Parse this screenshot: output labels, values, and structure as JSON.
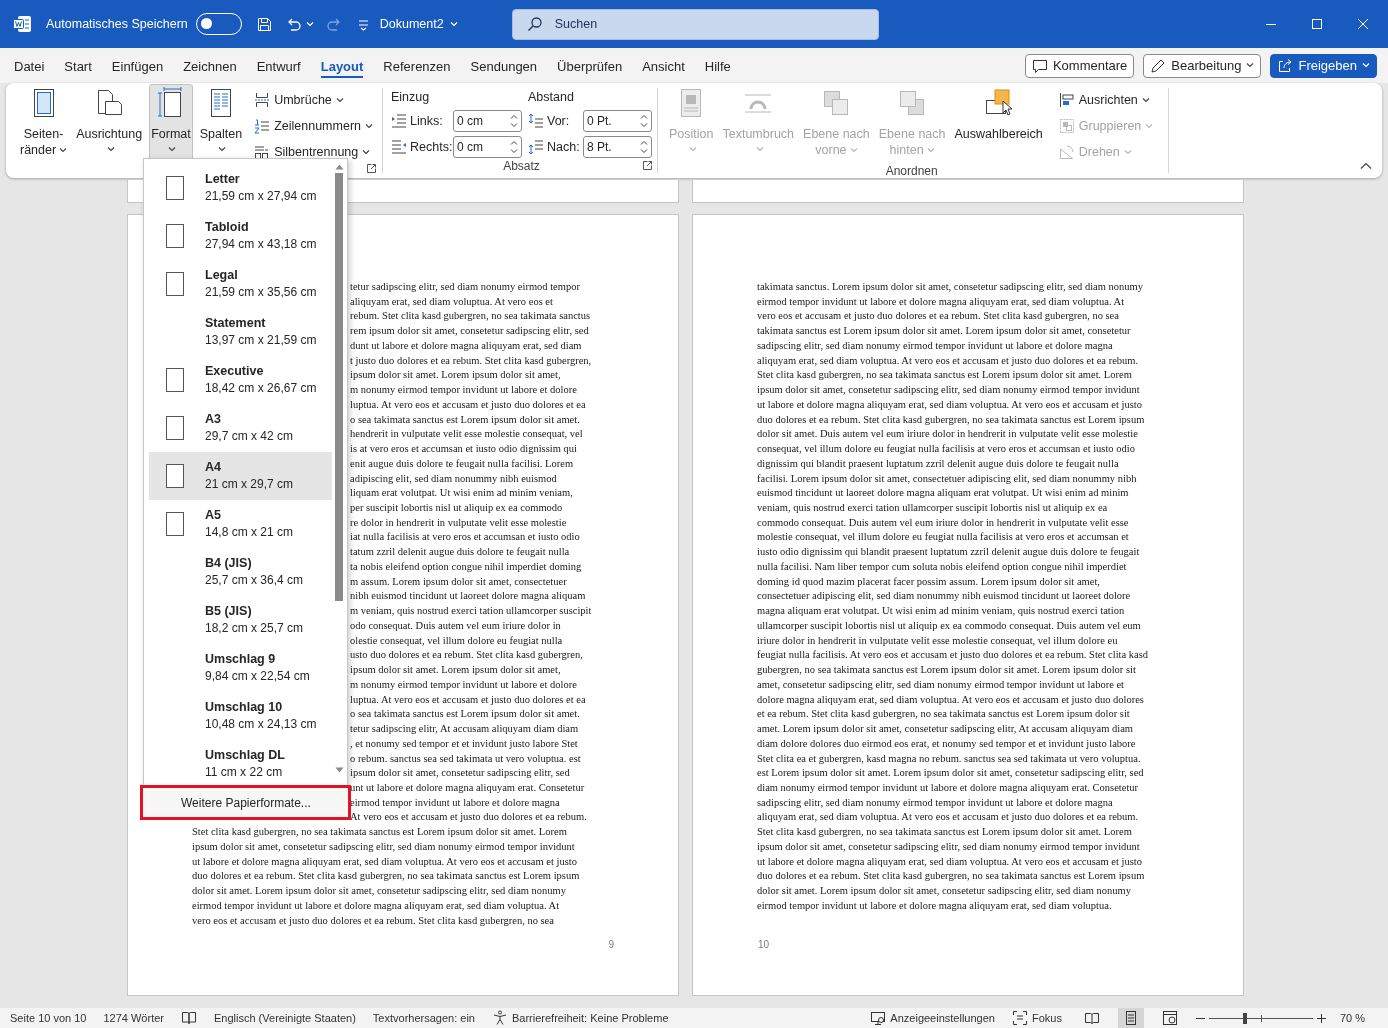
{
  "title_bar": {
    "autosave_label": "Automatisches Speichern",
    "autosave_on": false,
    "quick_access": [
      {
        "kind": "save",
        "disabled": false,
        "dropdown": false
      },
      {
        "kind": "undo",
        "disabled": false,
        "dropdown": true
      },
      {
        "kind": "redo",
        "disabled": true,
        "dropdown": false
      },
      {
        "kind": "customize",
        "disabled": false,
        "dropdown": false
      }
    ],
    "document": "Dokument2",
    "search_placeholder": "Suchen"
  },
  "menu_tabs": [
    {
      "label": "Datei",
      "selected": false
    },
    {
      "label": "Start",
      "selected": false
    },
    {
      "label": "Einfügen",
      "selected": false
    },
    {
      "label": "Zeichnen",
      "selected": false
    },
    {
      "label": "Entwurf",
      "selected": false
    },
    {
      "label": "Layout",
      "selected": true
    },
    {
      "label": "Referenzen",
      "selected": false
    },
    {
      "label": "Sendungen",
      "selected": false
    },
    {
      "label": "Überprüfen",
      "selected": false
    },
    {
      "label": "Ansicht",
      "selected": false
    },
    {
      "label": "Hilfe",
      "selected": false
    }
  ],
  "header_buttons": [
    {
      "kind": "comments",
      "label": "Kommentare"
    },
    {
      "kind": "editing",
      "label": "Bearbeitung"
    },
    {
      "kind": "share",
      "label": "Freigeben"
    }
  ],
  "ribbon": {
    "page_setup": {
      "large_buttons": [
        {
          "kind": "margins",
          "lines": [
            "Seiten-",
            "ränder"
          ],
          "dropdown": true,
          "expanded": false,
          "disabled": false
        },
        {
          "kind": "orientation",
          "lines": [
            "Ausrichtung"
          ],
          "dropdown": true,
          "expanded": false,
          "disabled": false
        },
        {
          "kind": "paper-size",
          "lines": [
            "Format"
          ],
          "dropdown": true,
          "expanded": true,
          "disabled": false
        },
        {
          "kind": "columns",
          "lines": [
            "Spalten"
          ],
          "dropdown": true,
          "expanded": false,
          "disabled": false
        }
      ],
      "small_buttons": [
        {
          "kind": "breaks",
          "label": "Umbrüche",
          "dropdown": true,
          "disabled": false
        },
        {
          "kind": "line-numbers",
          "label": "Zeilennummern",
          "dropdown": true,
          "disabled": false
        },
        {
          "kind": "hyphenation",
          "label": "Silbentrennung",
          "dropdown": true,
          "disabled": false
        }
      ]
    },
    "paragraph": {
      "label": "Absatz",
      "columns": [
        {
          "title": "Einzug",
          "fields": [
            {
              "kind": "indent-left",
              "label": "Links:",
              "value": "0 cm"
            },
            {
              "kind": "indent-right",
              "label": "Rechts:",
              "value": "0 cm"
            }
          ]
        },
        {
          "title": "Abstand",
          "fields": [
            {
              "kind": "spacing-before",
              "label": "Vor:",
              "value": "0 Pt."
            },
            {
              "kind": "spacing-after",
              "label": "Nach:",
              "value": "8 Pt."
            }
          ]
        }
      ]
    },
    "arrange": {
      "label": "Anordnen",
      "large_buttons": [
        {
          "kind": "position",
          "lines": [
            "Position"
          ],
          "dropdown": true,
          "expanded": false,
          "disabled": true
        },
        {
          "kind": "text-wrap",
          "lines": [
            "Textumbruch"
          ],
          "dropdown": true,
          "expanded": false,
          "disabled": true
        },
        {
          "kind": "bring-forward",
          "lines": [
            "Ebene nach",
            "vorne"
          ],
          "dropdown": true,
          "expanded": false,
          "disabled": true
        },
        {
          "kind": "send-backward",
          "lines": [
            "Ebene nach",
            "hinten"
          ],
          "dropdown": true,
          "expanded": false,
          "disabled": true
        },
        {
          "kind": "selection-pane",
          "lines": [
            "Auswahlbereich"
          ],
          "dropdown": false,
          "expanded": false,
          "disabled": false
        }
      ],
      "small_buttons": [
        {
          "kind": "align",
          "label": "Ausrichten",
          "dropdown": true,
          "disabled": false
        },
        {
          "kind": "group",
          "label": "Gruppieren",
          "dropdown": true,
          "disabled": true
        },
        {
          "kind": "rotate",
          "label": "Drehen",
          "dropdown": true,
          "disabled": true
        }
      ]
    }
  },
  "paper_menu": {
    "items": [
      {
        "kind": "with-icon",
        "name": "Letter",
        "size": "21,59 cm x 27,94 cm",
        "selected": false
      },
      {
        "kind": "with-icon",
        "name": "Tabloid",
        "size": "27,94 cm x 43,18 cm",
        "selected": false
      },
      {
        "kind": "with-icon",
        "name": "Legal",
        "size": "21,59 cm x 35,56 cm",
        "selected": false
      },
      {
        "kind": "text-only",
        "name": "Statement",
        "size": "13,97 cm x 21,59 cm",
        "selected": false
      },
      {
        "kind": "with-icon",
        "name": "Executive",
        "size": "18,42 cm x 26,67 cm",
        "selected": false
      },
      {
        "kind": "with-icon",
        "name": "A3",
        "size": "29,7 cm x 42 cm",
        "selected": false
      },
      {
        "kind": "with-icon",
        "name": "A4",
        "size": "21 cm x 29,7 cm",
        "selected": true
      },
      {
        "kind": "with-icon",
        "name": "A5",
        "size": "14,8 cm x 21 cm",
        "selected": false
      },
      {
        "kind": "text-only",
        "name": "B4 (JIS)",
        "size": "25,7 cm x 36,4 cm",
        "selected": false
      },
      {
        "kind": "text-only",
        "name": "B5 (JIS)",
        "size": "18,2 cm x 25,7 cm",
        "selected": false
      },
      {
        "kind": "text-only",
        "name": "Umschlag 9",
        "size": "9,84 cm x 22,54 cm",
        "selected": false
      },
      {
        "kind": "text-only",
        "name": "Umschlag 10",
        "size": "10,48 cm x 24,13 cm",
        "selected": false
      },
      {
        "kind": "text-only",
        "name": "Umschlag DL",
        "size": "11 cm x 22 cm",
        "selected": false
      }
    ],
    "more": {
      "label": "Weitere Papierformate...",
      "highlighted": true
    }
  },
  "pages": [
    {
      "number": "9",
      "partial_lines": [
        "tetur sadipscing elitr, sed diam nonumy eirmod tempor",
        "aliquyam erat, sed diam voluptua. At vero eos et",
        "rebum. Stet clita kasd gubergren, no sea takimata sanctus",
        "rem ipsum dolor sit amet, consetetur sadipscing elitr, sed",
        "dunt ut labore et dolore magna aliquyam erat, sed diam",
        "t justo duo dolores et ea rebum. Stet clita kasd gubergren,",
        "ipsum dolor sit amet. Lorem ipsum dolor sit amet,",
        "m nonumy eirmod tempor invidunt ut labore et dolore",
        "luptua. At vero eos et accusam et justo duo dolores et ea",
        "o sea takimata sanctus est Lorem ipsum dolor sit amet.",
        "hendrerit in vulputate velit esse molestie consequat, vel",
        "is at vero eros et accumsan et iusto odio dignissim qui",
        "enit augue duis dolore te feugait nulla facilisi. Lorem",
        "adipiscing elit, sed diam nonummy nibh euismod",
        "liquam erat volutpat. Ut wisi enim ad minim veniam,",
        "per suscipit lobortis nisl ut aliquip ex ea commodo",
        "re dolor in hendrerit in vulputate velit esse molestie",
        "iat nulla facilisis at vero eros et accumsan et iusto odio",
        "tatum zzril delenit augue duis dolore te feugait nulla",
        "ta nobis eleifend option congue nihil imperdiet doming",
        "m assum. Lorem ipsum dolor sit amet, consectetuer",
        "nibh euismod tincidunt ut laoreet dolore magna aliquam",
        "m veniam, quis nostrud exerci tation ullamcorper suscipit",
        "odo consequat. Duis autem vel eum iriure dolor in",
        "olestie consequat, vel illum dolore eu feugiat nulla",
        "usto duo dolores et ea rebum. Stet clita kasd gubergren,",
        "ipsum dolor sit amet. Lorem ipsum dolor sit amet,",
        "m nonumy eirmod tempor invidunt ut labore et dolore",
        "luptua. At vero eos et accusam et justo duo dolores et ea",
        "o sea takimata sanctus est Lorem ipsum dolor sit amet.",
        "tetur sadipscing elitr, At accusam aliquyam diam diam",
        ", et nonumy sed tempor et et invidunt justo labore Stet",
        "o rebum. sanctus sea sed takimata ut vero voluptua. est",
        "ipsum dolor sit amet, consetetur sadipscing elitr, sed",
        "unt ut labore et dolore magna aliquyam erat. Consetetur",
        "eirmod tempor invidunt ut labore et dolore magna",
        "At vero eos et accusam et justo duo dolores et ea rebum."
      ],
      "lines": [
        "Stet clita kasd gubergren, no sea takimata sanctus est Lorem ipsum dolor sit amet. Lorem",
        "ipsum dolor sit amet, consetetur sadipscing elitr, sed diam nonumy eirmod tempor invidunt",
        "ut labore et dolore magna aliquyam erat, sed diam voluptua. At vero eos et accusam et justo",
        "duo dolores et ea rebum. Stet clita kasd gubergren, no sea takimata sanctus est Lorem ipsum",
        "dolor sit amet. Lorem ipsum dolor sit amet, consetetur sadipscing elitr, sed diam nonumy",
        "eirmod tempor invidunt ut labore et dolore magna aliquyam erat, sed diam voluptua. At",
        "vero eos et accusam et justo duo dolores et ea rebum. Stet clita kasd gubergren, no sea"
      ]
    },
    {
      "number": "10",
      "lines": [
        "takimata sanctus. Lorem ipsum dolor sit amet, consetetur sadipscing elitr, sed diam nonumy",
        "eirmod tempor invidunt ut labore et dolore magna aliquyam erat, sed diam voluptua. At",
        "vero eos et accusam et justo duo dolores et ea rebum. Stet clita kasd gubergren, no sea",
        "takimata sanctus est Lorem ipsum dolor sit amet. Lorem ipsum dolor sit amet, consetetur",
        "sadipscing elitr, sed diam nonumy eirmod tempor invidunt ut labore et dolore magna",
        "aliquyam erat, sed diam voluptua. At vero eos et accusam et justo duo dolores et ea rebum.",
        "Stet clita kasd gubergren, no sea takimata sanctus est Lorem ipsum dolor sit amet. Lorem",
        "ipsum dolor sit amet, consetetur sadipscing elitr, sed diam nonumy eirmod tempor invidunt",
        "ut labore et dolore magna aliquyam erat, sed diam voluptua. At vero eos et accusam et justo",
        "duo dolores et ea rebum. Stet clita kasd gubergren, no sea takimata sanctus est Lorem ipsum",
        "dolor sit amet. Duis autem vel eum iriure dolor in hendrerit in vulputate velit esse molestie",
        "consequat, vel illum dolore eu feugiat nulla facilisis at vero eros et accumsan et iusto odio",
        "dignissim qui blandit praesent luptatum zzril delenit augue duis dolore te feugait nulla",
        "facilisi. Lorem ipsum dolor sit amet, consectetuer adipiscing elit, sed diam nonummy nibh",
        "euismod tincidunt ut laoreet dolore magna aliquam erat volutpat. Ut wisi enim ad minim",
        "veniam, quis nostrud exerci tation ullamcorper suscipit lobortis nisl ut aliquip ex ea",
        "commodo consequat. Duis autem vel eum iriure dolor in hendrerit in vulputate velit esse",
        "molestie consequat, vel illum dolore eu feugiat nulla facilisis at vero eros et accumsan et",
        "iusto odio dignissim qui blandit praesent luptatum zzril delenit augue duis dolore te feugait",
        "nulla facilisi. Nam liber tempor cum soluta nobis eleifend option congue nihil imperdiet",
        "doming id quod mazim placerat facer possim assum. Lorem ipsum dolor sit amet,",
        "consectetuer adipiscing elit, sed diam nonummy nibh euismod tincidunt ut laoreet dolore",
        "magna aliquam erat volutpat. Ut wisi enim ad minim veniam, quis nostrud exerci tation",
        "ullamcorper suscipit lobortis nisl ut aliquip ex ea commodo consequat. Duis autem vel eum",
        "iriure dolor in hendrerit in vulputate velit esse molestie consequat, vel illum dolore eu",
        "feugiat nulla facilisis. At vero eos et accusam et justo duo dolores et ea rebum. Stet clita kasd",
        "gubergren, no sea takimata sanctus est Lorem ipsum dolor sit amet. Lorem ipsum dolor sit",
        "amet, consetetur sadipscing elitr, sed diam nonumy eirmod tempor invidunt ut labore et",
        "dolore magna aliquyam erat, sed diam voluptua. At vero eos et accusam et justo duo dolores",
        "et ea rebum. Stet clita kasd gubergren, no sea takimata sanctus est Lorem ipsum dolor sit",
        "amet. Lorem ipsum dolor sit amet, consetetur sadipscing elitr, At accusam aliquyam diam",
        "diam dolore dolores duo eirmod eos erat, et nonumy sed tempor et et invidunt justo labore",
        "Stet clita ea et gubergren, kasd magna no rebum. sanctus sea sed takimata ut vero voluptua.",
        "est Lorem ipsum dolor sit amet. Lorem ipsum dolor sit amet, consetetur sadipscing elitr, sed",
        "diam nonumy eirmod tempor invidunt ut labore et dolore magna aliquyam erat. Consetetur",
        "sadipscing elitr, sed diam nonumy eirmod tempor invidunt ut labore et dolore magna",
        "aliquyam erat, sed diam voluptua. At vero eos et accusam et justo duo dolores et ea rebum.",
        "Stet clita kasd gubergren, no sea takimata sanctus est Lorem ipsum dolor sit amet. Lorem",
        "ipsum dolor sit amet, consetetur sadipscing elitr, sed diam nonumy eirmod tempor invidunt",
        "ut labore et dolore magna aliquyam erat, sed diam voluptua. At vero eos et accusam et justo",
        "duo dolores et ea rebum. Stet clita kasd gubergren, no sea takimata sanctus est Lorem ipsum",
        "dolor sit amet. Lorem ipsum dolor sit amet, consetetur sadipscing elitr, sed diam nonumy",
        "eirmod tempor invidunt ut labore et dolore magna aliquyam erat, sed diam voluptua."
      ]
    }
  ],
  "status_bar": {
    "left": [
      {
        "kind": "text",
        "label": "Seite 10 von 10"
      },
      {
        "kind": "text",
        "label": "1274 Wörter"
      },
      {
        "kind": "proofing"
      },
      {
        "kind": "text",
        "label": "Englisch (Vereinigte Staaten)"
      },
      {
        "kind": "text",
        "label": "Textvorhersagen: ein"
      },
      {
        "kind": "accessibility",
        "label": "Barrierefreiheit: Keine Probleme"
      }
    ],
    "right": [
      {
        "kind": "display-settings",
        "label": "Anzeigeeinstellungen"
      },
      {
        "kind": "focus",
        "label": "Fokus"
      }
    ],
    "views": [
      {
        "kind": "read",
        "selected": false
      },
      {
        "kind": "print",
        "selected": true
      },
      {
        "kind": "web",
        "selected": false
      }
    ],
    "zoom": {
      "level": 0.35,
      "label": "70 %"
    }
  }
}
